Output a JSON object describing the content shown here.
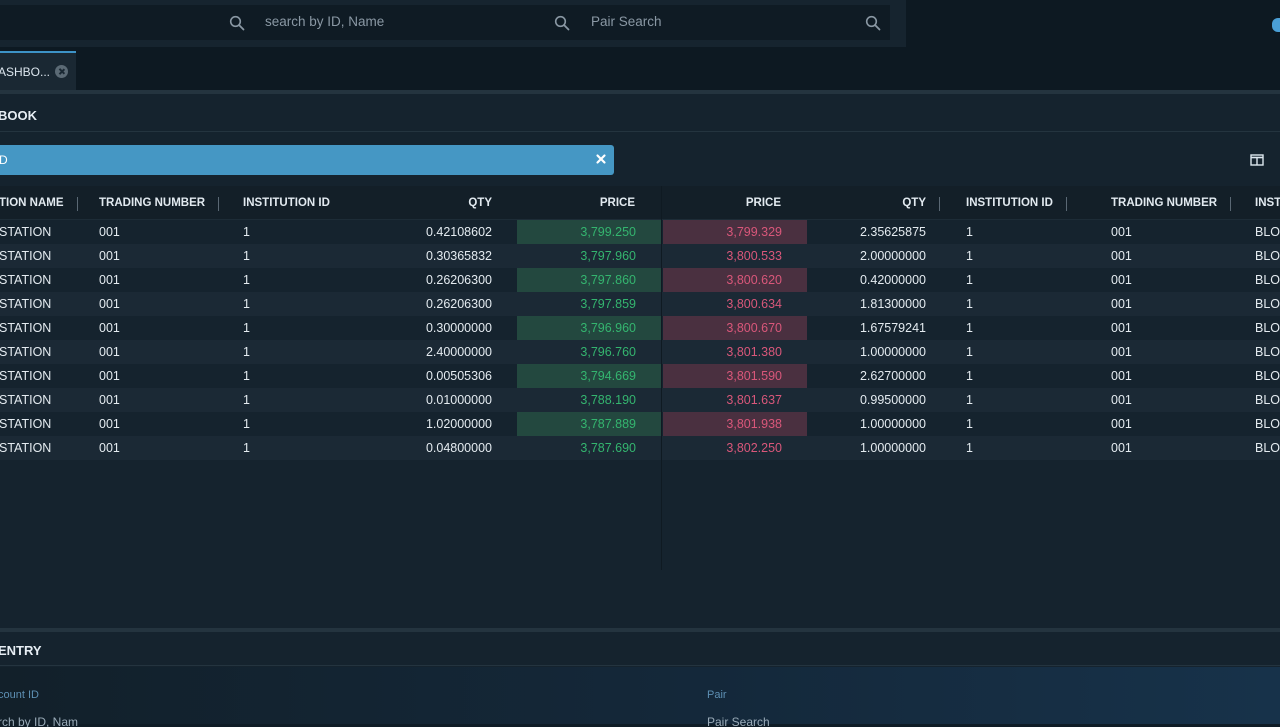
{
  "search": {
    "id_placeholder": "search by ID, Name",
    "pair_placeholder": "Pair Search"
  },
  "tabs": [
    {
      "label": "ASHBO..."
    }
  ],
  "panel": {
    "title": "BOOK",
    "filter_label": "D"
  },
  "table": {
    "bid_headers": {
      "institution_name": "TION NAME",
      "trading_number": "TRADING NUMBER",
      "institution_id": "INSTITUTION ID",
      "qty": "QTY",
      "price": "PRICE"
    },
    "ask_headers": {
      "price": "PRICE",
      "qty": "QTY",
      "institution_id": "INSTITUTION ID",
      "trading_number": "TRADING NUMBER",
      "institution_name": "INST"
    },
    "rows": [
      {
        "bid_name": "STATION",
        "bid_tn": "001",
        "bid_iid": "1",
        "bid_qty": "0.42108602",
        "bid_price": "3,799.250",
        "ask_price": "3,799.329",
        "ask_qty": "2.35625875",
        "ask_iid": "1",
        "ask_tn": "001",
        "ask_name": "BLO"
      },
      {
        "bid_name": "STATION",
        "bid_tn": "001",
        "bid_iid": "1",
        "bid_qty": "0.30365832",
        "bid_price": "3,797.960",
        "ask_price": "3,800.533",
        "ask_qty": "2.00000000",
        "ask_iid": "1",
        "ask_tn": "001",
        "ask_name": "BLO"
      },
      {
        "bid_name": "STATION",
        "bid_tn": "001",
        "bid_iid": "1",
        "bid_qty": "0.26206300",
        "bid_price": "3,797.860",
        "ask_price": "3,800.620",
        "ask_qty": "0.42000000",
        "ask_iid": "1",
        "ask_tn": "001",
        "ask_name": "BLO"
      },
      {
        "bid_name": "STATION",
        "bid_tn": "001",
        "bid_iid": "1",
        "bid_qty": "0.26206300",
        "bid_price": "3,797.859",
        "ask_price": "3,800.634",
        "ask_qty": "1.81300000",
        "ask_iid": "1",
        "ask_tn": "001",
        "ask_name": "BLO"
      },
      {
        "bid_name": "STATION",
        "bid_tn": "001",
        "bid_iid": "1",
        "bid_qty": "0.30000000",
        "bid_price": "3,796.960",
        "ask_price": "3,800.670",
        "ask_qty": "1.67579241",
        "ask_iid": "1",
        "ask_tn": "001",
        "ask_name": "BLO"
      },
      {
        "bid_name": "STATION",
        "bid_tn": "001",
        "bid_iid": "1",
        "bid_qty": "2.40000000",
        "bid_price": "3,796.760",
        "ask_price": "3,801.380",
        "ask_qty": "1.00000000",
        "ask_iid": "1",
        "ask_tn": "001",
        "ask_name": "BLO"
      },
      {
        "bid_name": "STATION",
        "bid_tn": "001",
        "bid_iid": "1",
        "bid_qty": "0.00505306",
        "bid_price": "3,794.669",
        "ask_price": "3,801.590",
        "ask_qty": "2.62700000",
        "ask_iid": "1",
        "ask_tn": "001",
        "ask_name": "BLO"
      },
      {
        "bid_name": "STATION",
        "bid_tn": "001",
        "bid_iid": "1",
        "bid_qty": "0.01000000",
        "bid_price": "3,788.190",
        "ask_price": "3,801.637",
        "ask_qty": "0.99500000",
        "ask_iid": "1",
        "ask_tn": "001",
        "ask_name": "BLO"
      },
      {
        "bid_name": "STATION",
        "bid_tn": "001",
        "bid_iid": "1",
        "bid_qty": "1.02000000",
        "bid_price": "3,787.889",
        "ask_price": "3,801.938",
        "ask_qty": "1.00000000",
        "ask_iid": "1",
        "ask_tn": "001",
        "ask_name": "BLO"
      },
      {
        "bid_name": "STATION",
        "bid_tn": "001",
        "bid_iid": "1",
        "bid_qty": "0.04800000",
        "bid_price": "3,787.690",
        "ask_price": "3,802.250",
        "ask_qty": "1.00000000",
        "ask_iid": "1",
        "ask_tn": "001",
        "ask_name": "BLO"
      }
    ]
  },
  "entry": {
    "title": "ENTRY",
    "account_label": "count ID",
    "account_value": "rch by ID, Nam",
    "pair_label": "Pair",
    "pair_value": "Pair Search"
  },
  "colors": {
    "accent": "#4597c4",
    "bid_price": "#34b56f",
    "ask_price": "#d9577a"
  }
}
